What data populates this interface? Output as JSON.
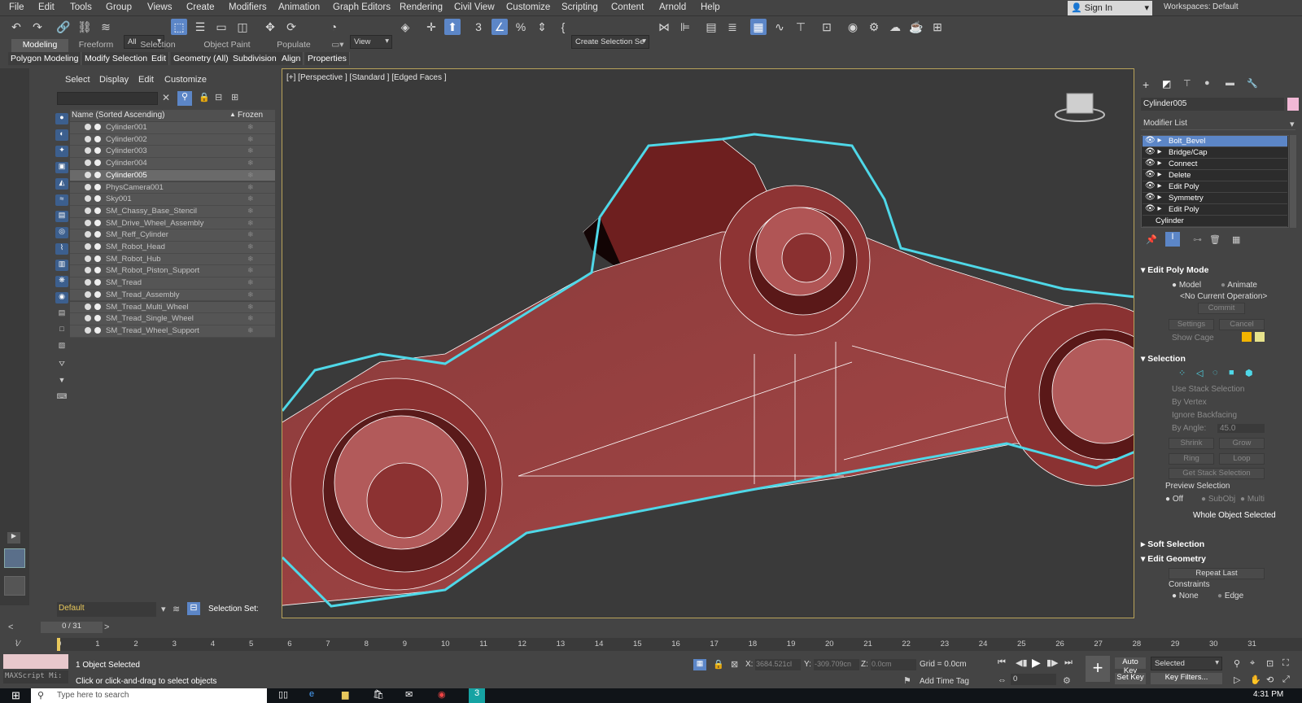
{
  "menubar": {
    "items": [
      "File",
      "Edit",
      "Tools",
      "Group",
      "Views",
      "Create",
      "Modifiers",
      "Animation",
      "Graph Editors",
      "Rendering",
      "Civil View",
      "Customize",
      "Scripting",
      "Content",
      "Arnold",
      "Help"
    ],
    "signin": "Sign In",
    "workspaces_label": "Workspaces:",
    "workspace": "Default"
  },
  "toolbar": {
    "filter_dropdown": "All",
    "view_dropdown": "View",
    "selection_set": "Create Selection Se"
  },
  "ribbon": {
    "tabs": [
      "Modeling",
      "Freeform",
      "Selection",
      "Object Paint",
      "Populate"
    ],
    "subtabs": [
      "Polygon Modeling",
      "Modify Selection",
      "Edit",
      "Geometry (All)",
      "Subdivision",
      "Align",
      "Properties"
    ]
  },
  "scene_explorer": {
    "menu": [
      "Select",
      "Display",
      "Edit",
      "Customize"
    ],
    "col_name": "Name (Sorted Ascending)",
    "col_frozen": "Frozen",
    "sort_arrow": "▲",
    "rows": [
      "Cylinder001",
      "Cylinder002",
      "Cylinder003",
      "Cylinder004",
      "Cylinder005",
      "PhysCamera001",
      "Sky001",
      "SM_Chassy_Base_Stencil",
      "SM_Drive_Wheel_Assembly",
      "SM_Reff_Cylinder",
      "SM_Robot_Head",
      "SM_Robot_Hub",
      "SM_Robot_Piston_Support",
      "SM_Tread",
      "SM_Tread_Assembly",
      "SM_Tread_Multi_Wheel",
      "SM_Tread_Single_Wheel",
      "SM_Tread_Wheel_Support"
    ],
    "selected_row": "Cylinder005",
    "layer": "Default",
    "selection_set_label": "Selection Set:"
  },
  "viewport": {
    "label": "[+] [Perspective ] [Standard ] [Edged Faces ]"
  },
  "command_panel": {
    "object_name": "Cylinder005",
    "color": "#f2b8d6",
    "modifier_list": "Modifier List",
    "modifiers": [
      "Bolt_Bevel",
      "Bridge/Cap",
      "Connect",
      "Delete",
      "Edit Poly",
      "Symmetry",
      "Edit Poly",
      "Cylinder"
    ],
    "edit_poly_mode": {
      "title": "Edit Poly Mode",
      "model": "Model",
      "animate": "Animate",
      "op": "<No Current Operation>",
      "commit": "Commit",
      "settings": "Settings",
      "cancel": "Cancel",
      "show_cage": "Show Cage"
    },
    "selection": {
      "title": "Selection",
      "use_stack": "Use Stack Selection",
      "by_vertex": "By Vertex",
      "ignore_backfacing": "Ignore Backfacing",
      "by_angle": "By Angle:",
      "angle": "45.0",
      "shrink": "Shrink",
      "grow": "Grow",
      "ring": "Ring",
      "loop": "Loop",
      "get_stack": "Get Stack Selection",
      "preview": "Preview Selection",
      "off": "Off",
      "subobj": "SubObj",
      "multi": "Multi",
      "status": "Whole Object Selected"
    },
    "soft_selection": "Soft Selection",
    "edit_geometry": {
      "title": "Edit Geometry",
      "repeat_last": "Repeat Last",
      "constraints": "Constraints",
      "none": "None",
      "edge": "Edge"
    }
  },
  "timeline": {
    "frame": "0 / 31",
    "ticks": [
      "0",
      "1",
      "2",
      "3",
      "4",
      "5",
      "6",
      "7",
      "8",
      "9",
      "10",
      "11",
      "12",
      "13",
      "14",
      "15",
      "16",
      "17",
      "18",
      "19",
      "20",
      "21",
      "22",
      "23",
      "24",
      "25",
      "26",
      "27",
      "28",
      "29",
      "30",
      "31"
    ]
  },
  "status": {
    "maxscript": "MAXScript Mi:",
    "selected": "1 Object Selected",
    "hint": "Click or click-and-drag to select objects",
    "x_label": "X:",
    "x": "3684.521cl",
    "y_label": "Y:",
    "y": "-309.709cn",
    "z_label": "Z:",
    "z": "0.0cm",
    "grid": "Grid = 0.0cm",
    "add_time_tag": "Add Time Tag",
    "auto_key": "Auto Key",
    "set_key": "Set Key",
    "key_mode": "Selected",
    "key_filters": "Key Filters...",
    "frame_field": "0"
  },
  "taskbar": {
    "search": "Type here to search",
    "time": "4:31 PM"
  }
}
